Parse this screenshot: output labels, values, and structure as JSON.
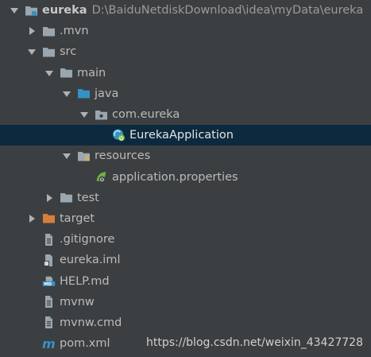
{
  "project": {
    "name": "eureka",
    "path": "D:\\BaiduNetdiskDownload\\idea\\myData\\eureka"
  },
  "tree": [
    {
      "label": "eureka",
      "depth": 0,
      "arrow": "down",
      "icon": "project-folder-icon"
    },
    {
      "label": ".mvn",
      "depth": 1,
      "arrow": "right",
      "icon": "folder-icon"
    },
    {
      "label": "src",
      "depth": 1,
      "arrow": "down",
      "icon": "folder-icon"
    },
    {
      "label": "main",
      "depth": 2,
      "arrow": "down",
      "icon": "folder-icon"
    },
    {
      "label": "java",
      "depth": 3,
      "arrow": "down",
      "icon": "source-folder-icon"
    },
    {
      "label": "com.eureka",
      "depth": 4,
      "arrow": "down",
      "icon": "package-icon"
    },
    {
      "label": "EurekaApplication",
      "depth": 5,
      "arrow": "none",
      "icon": "spring-boot-class-icon",
      "selected": true
    },
    {
      "label": "resources",
      "depth": 3,
      "arrow": "down",
      "icon": "resources-folder-icon"
    },
    {
      "label": "application.properties",
      "depth": 4,
      "arrow": "none",
      "icon": "spring-properties-icon"
    },
    {
      "label": "test",
      "depth": 2,
      "arrow": "right",
      "icon": "folder-icon"
    },
    {
      "label": "target",
      "depth": 1,
      "arrow": "right",
      "icon": "excluded-folder-icon"
    },
    {
      "label": ".gitignore",
      "depth": 1,
      "arrow": "none",
      "icon": "text-file-icon"
    },
    {
      "label": "eureka.iml",
      "depth": 1,
      "arrow": "none",
      "icon": "iml-file-icon"
    },
    {
      "label": "HELP.md",
      "depth": 1,
      "arrow": "none",
      "icon": "markdown-file-icon"
    },
    {
      "label": "mvnw",
      "depth": 1,
      "arrow": "none",
      "icon": "text-file-icon"
    },
    {
      "label": "mvnw.cmd",
      "depth": 1,
      "arrow": "none",
      "icon": "text-file-icon"
    },
    {
      "label": "pom.xml",
      "depth": 1,
      "arrow": "none",
      "icon": "maven-icon"
    }
  ],
  "watermark": "https://blog.csdn.net/weixin_43427728",
  "colors": {
    "background": "#3c3f41",
    "selection": "#0d293e",
    "folder": "#9aa7b0",
    "source_folder": "#3592c4",
    "excluded_folder": "#d67e3c",
    "spring": "#6db33f"
  }
}
